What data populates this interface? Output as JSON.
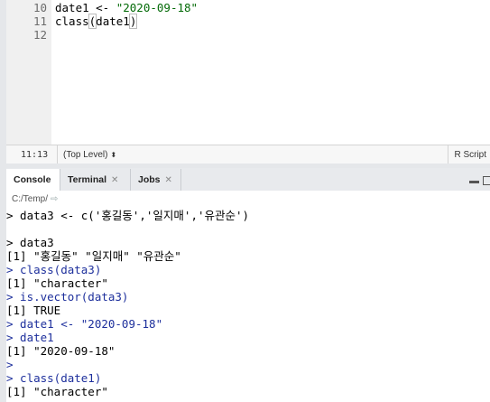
{
  "editor": {
    "lines": [
      {
        "num": "10",
        "parts": [
          {
            "text": "date1 <- ",
            "cls": ""
          },
          {
            "text": "\"2020-09-18\"",
            "cls": "str"
          }
        ]
      },
      {
        "num": "11",
        "parts": [
          {
            "text": "class",
            "cls": ""
          },
          {
            "text": "(",
            "cls": "paren-hl"
          },
          {
            "text": "date1",
            "cls": ""
          },
          {
            "text": ")",
            "cls": "paren-hl"
          }
        ],
        "caret": true
      },
      {
        "num": "12",
        "parts": []
      }
    ],
    "status": {
      "cursor_position": "11:13",
      "scope": "(Top Level)",
      "file_type": "R Script"
    }
  },
  "console_pane": {
    "tabs": [
      {
        "label": "Console",
        "closable": false,
        "active": true
      },
      {
        "label": "Terminal",
        "closable": true,
        "active": false
      },
      {
        "label": "Jobs",
        "closable": true,
        "active": false
      }
    ],
    "working_dir": "C:/Temp/",
    "lines": [
      {
        "text": "> data3 <- c('홍길동','일지매','유관순')",
        "kind": "plain"
      },
      {
        "text": "",
        "kind": "plain"
      },
      {
        "text": "> data3",
        "kind": "plain"
      },
      {
        "text": "[1] \"홍길동\" \"일지매\" \"유관순\"",
        "kind": "out"
      },
      {
        "text": "> class(data3)",
        "kind": "in"
      },
      {
        "text": "[1] \"character\"",
        "kind": "out"
      },
      {
        "text": "> is.vector(data3)",
        "kind": "in"
      },
      {
        "text": "[1] TRUE",
        "kind": "out"
      },
      {
        "text": "> date1 <- \"2020-09-18\"",
        "kind": "in"
      },
      {
        "text": "> date1",
        "kind": "in"
      },
      {
        "text": "[1] \"2020-09-18\"",
        "kind": "out"
      },
      {
        "text": ">",
        "kind": "in"
      },
      {
        "text": "> class(date1)",
        "kind": "in"
      },
      {
        "text": "[1] \"character\"",
        "kind": "out"
      }
    ]
  },
  "colors": {
    "console_input": "#1d2f9c",
    "string_literal": "#036a07"
  }
}
